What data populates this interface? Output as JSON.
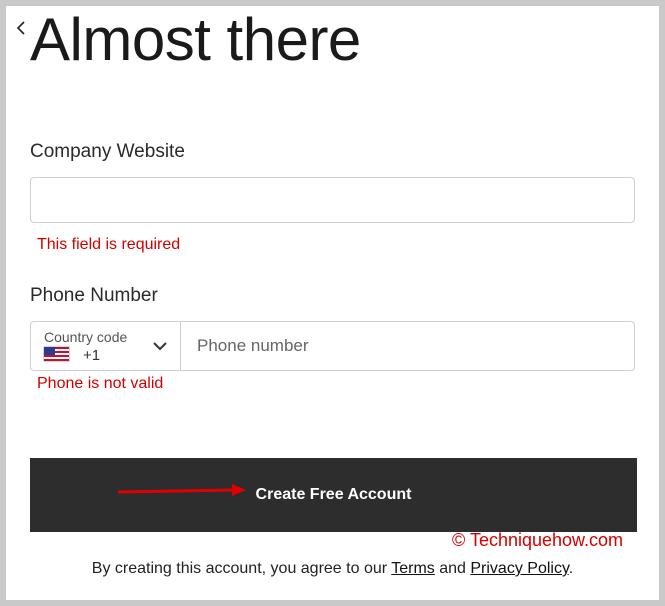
{
  "page": {
    "back_icon": "chevron-left-icon",
    "title": "Almost there"
  },
  "form": {
    "website": {
      "label": "Company Website",
      "value": "",
      "placeholder": "",
      "error": "This field is required"
    },
    "phone": {
      "label": "Phone Number",
      "country_label": "Country code",
      "country_flag": "us-flag-icon",
      "dial_code": "+1",
      "placeholder": "Phone number",
      "value": "",
      "error": "Phone is not valid"
    },
    "submit_label": "Create Free Account"
  },
  "annotation": {
    "arrow_color": "#e00000",
    "watermark": "© Techniquehow.com"
  },
  "consent": {
    "prefix": "By creating this account, you agree to our ",
    "terms": "Terms",
    "and": " and ",
    "privacy": "Privacy Policy",
    "suffix": "."
  },
  "colors": {
    "error": "#d40000",
    "button_bg": "#2d2d2d",
    "button_text": "#ffffff"
  }
}
